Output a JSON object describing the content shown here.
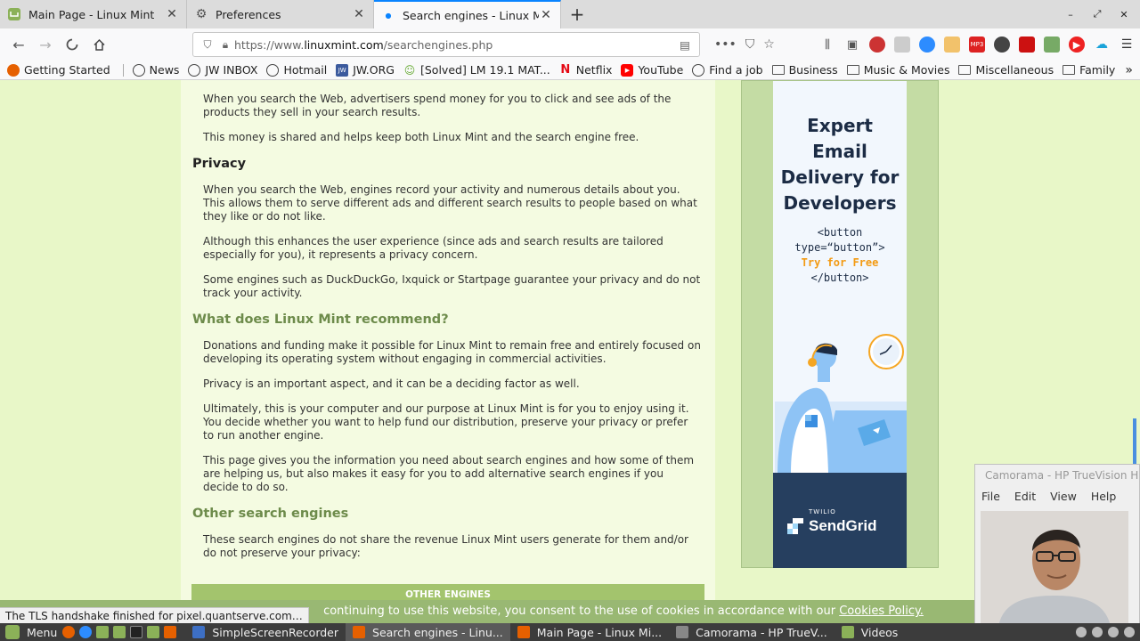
{
  "tabs": [
    {
      "title": "Main Page - Linux Mint",
      "icon": "mint-icon",
      "active": false
    },
    {
      "title": "Preferences",
      "icon": "gear-icon",
      "active": false
    },
    {
      "title": "Search engines - Linux Mint",
      "icon": "loading-dot-icon",
      "active": true
    }
  ],
  "nav": {
    "url_prefix": "https://www.",
    "url_host": "linuxmint.com",
    "url_path": "/searchengines.php",
    "page_actions_more": "•••"
  },
  "bookmarks": [
    {
      "label": "Getting Started",
      "icon": "firefox-icon"
    },
    {
      "label": "News",
      "icon": "globe-icon"
    },
    {
      "label": "JW INBOX",
      "icon": "globe-icon"
    },
    {
      "label": "Hotmail",
      "icon": "globe-icon"
    },
    {
      "label": "JW.ORG",
      "icon": "jw-icon"
    },
    {
      "label": "[Solved] LM 19.1 MAT...",
      "icon": "forum-icon"
    },
    {
      "label": "Netflix",
      "icon": "netflix-icon"
    },
    {
      "label": "YouTube",
      "icon": "youtube-icon"
    },
    {
      "label": "Find a job",
      "icon": "globe-icon"
    },
    {
      "label": "Business",
      "icon": "folder-icon"
    },
    {
      "label": "Music & Movies",
      "icon": "folder-icon"
    },
    {
      "label": "Miscellaneous",
      "icon": "folder-icon"
    },
    {
      "label": "Family",
      "icon": "folder-icon"
    }
  ],
  "content": {
    "p_ads_1": "When you search the Web, advertisers spend money for you to click and see ads of the products they sell in your search results.",
    "p_ads_2": "This money is shared and helps keep both Linux Mint and the search engine free.",
    "h_privacy": "Privacy",
    "p_privacy_1": "When you search the Web, engines record your activity and numerous details about you. This allows them to serve different ads and different search results to people based on what they like or do not like.",
    "p_privacy_2": "Although this enhances the user experience (since ads and search results are tailored especially for you), it represents a privacy concern.",
    "p_privacy_3": "Some engines such as DuckDuckGo, Ixquick or Startpage guarantee your privacy and do not track your activity.",
    "h_recommend": "What does Linux Mint recommend?",
    "p_rec_1": "Donations and funding make it possible for Linux Mint to remain free and entirely focused on developing its operating system without engaging in commercial activities.",
    "p_rec_2": "Privacy is an important aspect, and it can be a deciding factor as well.",
    "p_rec_3": "Ultimately, this is your computer and our purpose at Linux Mint is for you to enjoy using it. You decide whether you want to help fund our distribution, preserve your privacy or prefer to run another engine.",
    "p_rec_4": "This page gives you the information you need about search engines and how some of them are helping us, but also makes it easy for you to add alternative search engines if you decide to do so.",
    "h_other": "Other search engines",
    "p_other_1": "These search engines do not share the revenue Linux Mint users generate for them and/or do not preserve your privacy:",
    "other_table_header": "OTHER ENGINES"
  },
  "ad": {
    "headline_1": "Expert",
    "headline_2": "Email",
    "headline_3": "Delivery for",
    "headline_4": "Developers",
    "code_1": "<button",
    "code_2": "type=“button”>",
    "code_cta": "Try for Free",
    "code_3": "</button>",
    "twilio": "TWILIO",
    "sendgrid": "SendGrid"
  },
  "cookie": {
    "text": "continuing to use this website, you consent to the use of cookies in accordance with our",
    "link": "Cookies Policy."
  },
  "status": "The TLS handshake finished for pixel.quantserve.com…",
  "camorama": {
    "title": "Camorama - HP TrueVision HD",
    "menu": [
      "File",
      "Edit",
      "View",
      "Help"
    ]
  },
  "taskbar": {
    "menu_label": "Menu",
    "tasks": [
      {
        "label": "SimpleScreenRecorder",
        "color": "#3d6fc4",
        "active": false
      },
      {
        "label": "Search engines - Linu...",
        "color": "#e66000",
        "active": true
      },
      {
        "label": "Main Page - Linux Mi...",
        "color": "#e66000",
        "active": false
      },
      {
        "label": "Camorama - HP TrueV...",
        "color": "#888888",
        "active": false
      },
      {
        "label": "Videos",
        "color": "#8bb158",
        "active": false
      }
    ]
  },
  "colors": {
    "accent_tab": "#0a84ff",
    "page_bg": "#e8f7c8",
    "heading_green": "#6d8b4b",
    "cookie_bar": "#99b873",
    "ad_cta": "#f39a12",
    "ad_navy": "#263f5f"
  }
}
